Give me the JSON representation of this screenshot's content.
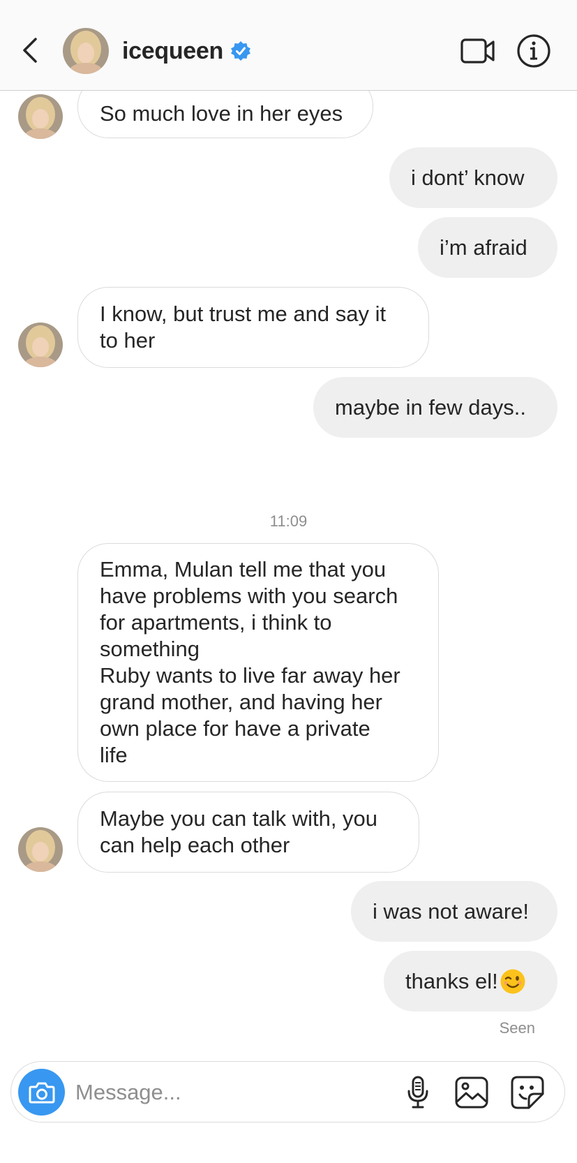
{
  "header": {
    "username": "icequeen",
    "icons": {
      "back": "back-chevron-icon",
      "verified": "verified-badge-icon",
      "video": "video-camera-icon",
      "info": "info-icon"
    },
    "accent_color": "#3897f0"
  },
  "messages": [
    {
      "direction": "incoming",
      "text": "So much love in her eyes",
      "avatar": true
    },
    {
      "direction": "outgoing",
      "text": "i dont’ know"
    },
    {
      "direction": "outgoing",
      "text": "i’m afraid"
    },
    {
      "direction": "incoming",
      "text": "I know, but trust me and say it\nto her",
      "avatar": true
    },
    {
      "direction": "outgoing",
      "text": "maybe in few days.."
    },
    {
      "direction": "incoming",
      "text": "Emma, Mulan tell me that you\nhave problems with you search\nfor apartments, i think to\nsomething\nRuby wants to live far away her\ngrand mother, and having her\nown place for have a private\nlife",
      "avatar": false
    },
    {
      "direction": "incoming",
      "text": "Maybe you can talk with, you\ncan help each other",
      "avatar": true
    },
    {
      "direction": "outgoing",
      "text": "i was not aware!"
    },
    {
      "direction": "outgoing",
      "text": "thanks el!",
      "emoji": "winking-face-emoji"
    }
  ],
  "timestamp": "11:09",
  "seen_label": "Seen",
  "composer": {
    "placeholder": "Message...",
    "value": "",
    "icons": {
      "camera": "camera-icon",
      "mic": "microphone-icon",
      "gallery": "gallery-icon",
      "sticker": "sticker-icon"
    }
  },
  "colors": {
    "incoming_bubble": "#ffffff",
    "outgoing_bubble": "#efefef",
    "bubble_border": "#dbdbdb",
    "meta_text": "#8e8e8e"
  }
}
